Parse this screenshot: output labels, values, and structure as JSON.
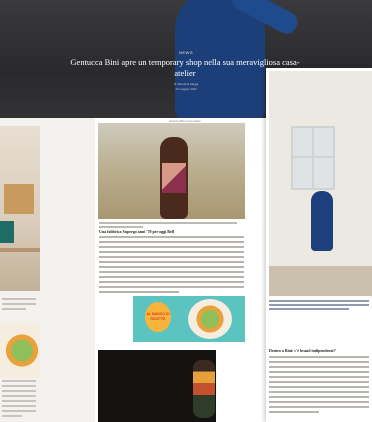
{
  "hero": {
    "category": "NEWS",
    "headline": "Gentucca Bini apre un temporary shop nella sua meravigliosa casa-atelier",
    "byline": "di Valentina Maggi",
    "date": "10 maggio 2022"
  },
  "middle_article": {
    "top_caption": "Gentucca Bini nel suo atelier",
    "sub_heading": "Una fabbrica Supergo anni '70 per oggi Bell"
  },
  "promo": {
    "badge_text": "AL BANCO DI RICETTE"
  },
  "right_article": {
    "section_heading": "Dentro a Bini: c'è brand indipendente?"
  }
}
